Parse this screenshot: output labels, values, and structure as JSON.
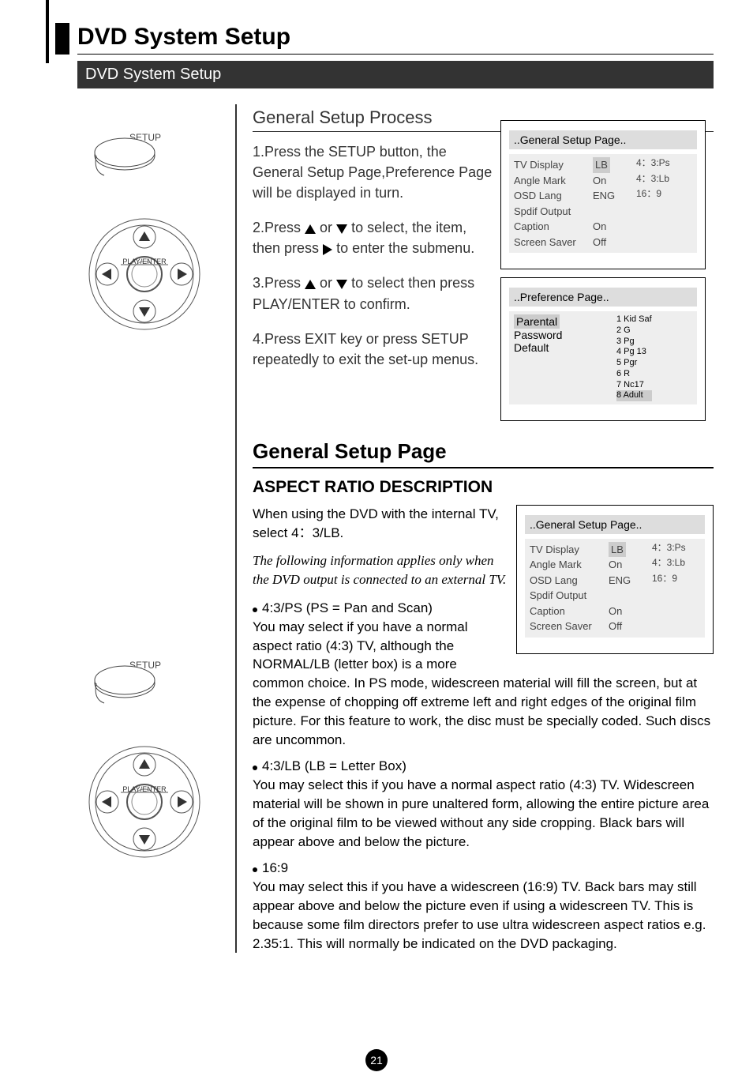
{
  "page": {
    "title": "DVD System Setup",
    "subtitle": "DVD System Setup",
    "pageNumber": "21"
  },
  "section1": {
    "heading": "General Setup Process",
    "step1": "1.Press the SETUP button, the General Setup Page,Preference Page  will be displayed in turn.",
    "step2a": "2.Press ",
    "step2b": " or ",
    "step2c": "  to select, the item, then press",
    "step2d": " to enter the submenu.",
    "step3a": "3.Press ",
    "step3b": " or ",
    "step3c": " to select then press PLAY/ENTER to confirm.",
    "step4": "4.Press EXIT key or press SETUP repeatedly to exit the set-up menus."
  },
  "osd1": {
    "header": "..General Setup Page..",
    "rows": [
      {
        "label": "TV Display",
        "val": "LB",
        "side": "4：3:Ps"
      },
      {
        "label": "Angle Mark",
        "val": "On",
        "side": "4：3:Lb"
      },
      {
        "label": "OSD Lang",
        "val": "ENG",
        "side": "16：9"
      },
      {
        "label": "Spdif Output",
        "val": "",
        "side": ""
      },
      {
        "label": "Caption",
        "val": "On",
        "side": ""
      },
      {
        "label": "Screen Saver",
        "val": "Off",
        "side": ""
      }
    ]
  },
  "osd2": {
    "header": "..Preference Page..",
    "leftItems": [
      "Parental",
      "Password",
      "Default"
    ],
    "rightItems": [
      "1 Kid Saf",
      "2 G",
      "3 Pg",
      "4 Pg 13",
      "5 Pgr",
      "6 R",
      "7 Nc17",
      "8 Adult"
    ]
  },
  "section2": {
    "title": "General Setup Page",
    "subtitle": "ASPECT RATIO DESCRIPTION",
    "intro": "When using the DVD with the internal TV, select 4：3/LB.",
    "italic": "The following information applies only when the DVD output is connected to an external TV.",
    "b1_label": "4:3/PS (PS = Pan and Scan)",
    "b1_text": "You may select if you have a normal aspect ratio (4:3) TV, although the NORMAL/LB (letter box) is a more common choice. In PS mode, widescreen material will fill the screen, but at the expense of chopping off extreme left and right edges of the original film picture. For this feature to work, the disc must be specially coded. Such discs are uncommon.",
    "b2_label": "4:3/LB (LB = Letter Box)",
    "b2_text": "You may select this if you have a normal aspect ratio (4:3) TV. Widescreen material will be shown in pure unaltered form, allowing the entire picture area of the original film to be viewed without any side cropping. Black bars will appear above and below the picture.",
    "b3_label": "16:9",
    "b3_text": "You may select this if you have a widescreen (16:9) TV. Back bars may still appear above and below the picture even if using a widescreen TV. This is because some film directors prefer to use ultra widescreen aspect ratios e.g. 2.35:1. This will normally be indicated on the DVD packaging."
  },
  "iconLabels": {
    "setup": "SETUP",
    "playEnter": "PLAY/ENTER"
  }
}
